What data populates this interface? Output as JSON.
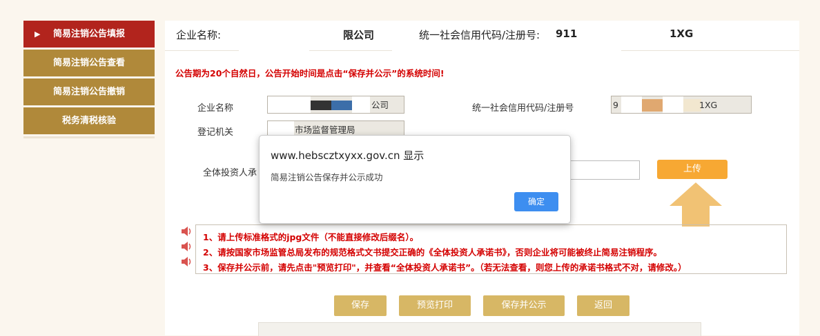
{
  "sidebar": {
    "items": [
      {
        "label": "简易注销公告填报"
      },
      {
        "label": "简易注销公告查看"
      },
      {
        "label": "简易注销公告撤销"
      },
      {
        "label": "税务清税核验"
      }
    ]
  },
  "header": {
    "company_label": "企业名称:",
    "company_value": "限公司",
    "code_label": "统一社会信用代码/注册号:",
    "code_value_prefix": "911",
    "code_value_suffix": "1XG"
  },
  "notice": "公告期为20个自然日，公告开始时间是点击“保存并公示”的系统时间!",
  "form": {
    "company_name_label": "企业名称",
    "company_name_value": "公司",
    "code_label": "统一社会信用代码/注册号",
    "code_value_prefix": "9",
    "code_value_suffix": "1XG",
    "authority_label": "登记机关",
    "authority_value": "市场监督管理局",
    "investor_label": "全体投资人承",
    "upload_label": "上传"
  },
  "tips": [
    "1、请上传标准格式的jpg文件（不能直接修改后缀名）。",
    "2、请按国家市场监管总局发布的规范格式文书提交正确的《全体投资人承诺书》，否则企业将可能被终止简易注销程序。",
    "3、保存并公示前，请先点击\"预览打印\"，并查看“全体投资人承诺书”。（若无法查看，则您上传的承诺书格式不对，请修改。）"
  ],
  "buttons": {
    "save": "保存",
    "preview": "预览打印",
    "save_publish": "保存并公示",
    "back": "返回"
  },
  "dialog": {
    "title": "www.hebscztxyxx.gov.cn 显示",
    "message": "简易注销公告保存并公示成功",
    "ok": "确定"
  },
  "colors": {
    "sidebar_active": "#b2241d",
    "sidebar_item": "#b0893a",
    "notice_red": "#d40000",
    "upload_orange": "#f7a833",
    "action_button": "#d7b765",
    "dialog_ok": "#3d8ef0"
  }
}
